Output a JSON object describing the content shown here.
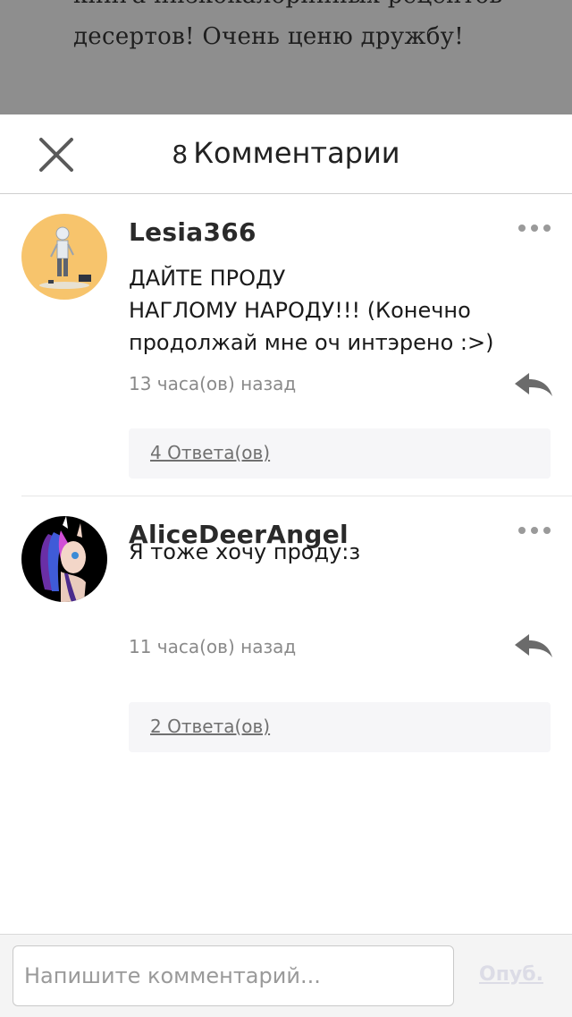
{
  "background_story": {
    "line1": "книга низкокалорийных рецептов",
    "line2": "десертов! Очень ценю дружбу!"
  },
  "header": {
    "count": "8",
    "title": "Комментарии",
    "close_icon": "close-icon"
  },
  "comments": [
    {
      "username": "Lesia366",
      "text": "ДАЙТЕ ПРОДУ\n НАГЛОМУ НАРОДУ!!! (Конечно продолжай мне оч интэрено :>)",
      "time": "13 часа(ов) назад",
      "replies": "4 Ответа(ов)",
      "avatar_icon": "avatar-drawing",
      "avatar_bg": "#f7c46c"
    },
    {
      "username": "AliceDeerAngel",
      "text": "Я тоже хочу проду:з",
      "time": "11 часа(ов) назад",
      "replies": "2 Ответа(ов)",
      "avatar_icon": "avatar-pony",
      "avatar_bg": "#000000"
    }
  ],
  "composer": {
    "placeholder": "Напишите комментарий...",
    "value": "",
    "publish_label": "Опуб."
  },
  "colors": {
    "overlay_bg": "#8e8e8e",
    "text_primary": "#1a1a1a",
    "text_secondary": "#8a8a8a",
    "reply_box_bg": "#f6f6f8",
    "publish_disabled": "#dcdce6"
  }
}
